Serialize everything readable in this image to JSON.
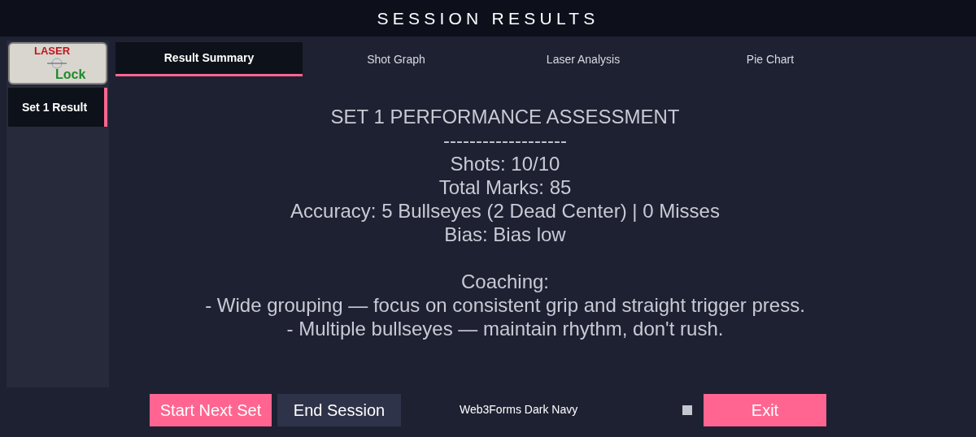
{
  "header": {
    "title": "SESSION RESULTS"
  },
  "logo": {
    "top": "LASER",
    "bottom": "Lock"
  },
  "sidebar": {
    "items": [
      {
        "label": "Set 1 Result",
        "selected": true
      }
    ]
  },
  "tabs": [
    {
      "label": "Result Summary",
      "selected": true
    },
    {
      "label": "Shot Graph",
      "selected": false
    },
    {
      "label": "Laser Analysis",
      "selected": false
    },
    {
      "label": "Pie Chart",
      "selected": false
    }
  ],
  "assessment": {
    "title": "SET 1 PERFORMANCE ASSESSMENT",
    "divider": "-------------------",
    "stats": [
      "Shots: 10/10",
      "Total Marks: 85",
      "Accuracy: 5 Bullseyes (2 Dead Center) | 0 Misses",
      "Bias: Bias low"
    ],
    "coaching_title": "Coaching:",
    "coaching": [
      "- Wide grouping — focus on consistent grip and straight trigger press.",
      "- Multiple bullseyes — maintain rhythm, don't rush."
    ]
  },
  "footer": {
    "start_button": "Start Next Set",
    "end_button": "End Session",
    "theme_label": "Web3Forms Dark Navy",
    "theme_checkbox": {
      "checked": false
    },
    "exit_button": "Exit"
  }
}
